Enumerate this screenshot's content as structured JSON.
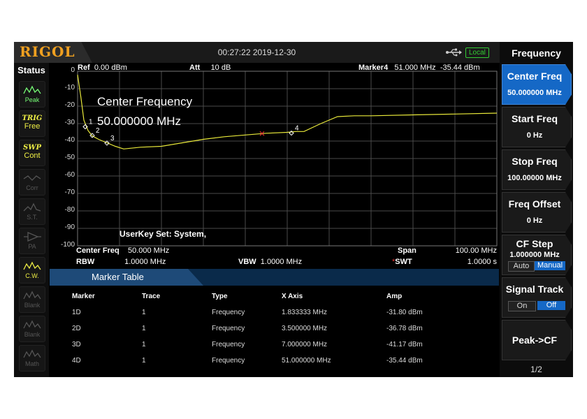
{
  "topbar": {
    "logo": "RIGOL",
    "datetime": "00:27:22 2019-12-30",
    "remote_badge": "Local"
  },
  "status": {
    "title": "Status",
    "items": [
      {
        "label": "Peak",
        "icon": "peak-search-icon",
        "state": "on"
      },
      {
        "icon_text": "TRIG",
        "label": "Free",
        "state": "yellow"
      },
      {
        "icon_text": "SWP",
        "label": "Cont",
        "state": "yellow"
      },
      {
        "label": "Corr",
        "icon": "correction-icon",
        "state": "dim"
      },
      {
        "label": "S.T.",
        "icon": "signal-track-icon",
        "state": "dim"
      },
      {
        "label": "PA",
        "icon": "preamp-icon",
        "state": "dim"
      },
      {
        "label": "C.W.",
        "icon": "clear-write-icon",
        "state": "yellow"
      },
      {
        "label": "Blank",
        "icon": "trace-blank-icon",
        "state": "dim"
      },
      {
        "label": "Blank",
        "icon": "trace-blank-icon",
        "state": "dim"
      },
      {
        "label": "Math",
        "icon": "trace-math-icon",
        "state": "dim"
      }
    ]
  },
  "header": {
    "ref_label": "Ref",
    "ref_value": "0.00 dBm",
    "att_label": "Att",
    "att_value": "10 dB",
    "marker_label": "Marker4",
    "marker_freq": "51.000 MHz",
    "marker_amp": "-35.44 dBm"
  },
  "y_axis_labels": [
    "0",
    "-10",
    "-20",
    "-30",
    "-40",
    "-50",
    "-60",
    "-70",
    "-80",
    "-90",
    "-100"
  ],
  "overlay": {
    "line1": "Center Frequency",
    "line2": "50.000000 MHz",
    "userkey": "UserKey Set:    System,"
  },
  "footer": {
    "center_freq_label": "Center Freq",
    "center_freq_value": "50.000 MHz",
    "span_label": "Span",
    "span_value": "100.00 MHz",
    "rbw_label": "RBW",
    "rbw_value": "1.0000 MHz",
    "vbw_label": "VBW",
    "vbw_value": "1.0000 MHz",
    "swt_flag": "*",
    "swt_label": "SWT",
    "swt_value": "1.0000 s"
  },
  "chart_data": {
    "type": "line",
    "x_range_mhz": [
      0,
      100
    ],
    "ylim": [
      -100,
      0
    ],
    "y_unit": "dBm",
    "grid": true,
    "series": [
      {
        "x": [
          0,
          0.8,
          1.5,
          2.5,
          3.5,
          5,
          7,
          9,
          11,
          15,
          20,
          25,
          30,
          35,
          40,
          45,
          50,
          52,
          54,
          58,
          62,
          66,
          70,
          80,
          90,
          100
        ],
        "y": [
          -2,
          -15,
          -28,
          -34,
          -37,
          -39,
          -41,
          -43,
          -44.5,
          -43.5,
          -43,
          -41,
          -39,
          -37.5,
          -36.5,
          -35.5,
          -35,
          -34.5,
          -34.5,
          -30,
          -26,
          -25.5,
          -25.5,
          -25,
          -24.5,
          -24
        ]
      }
    ],
    "markers": [
      {
        "label": "1",
        "x": 1.833333,
        "y": -31.8
      },
      {
        "label": "2",
        "x": 3.5,
        "y": -36.78
      },
      {
        "label": "3",
        "x": 7.0,
        "y": -41.17
      },
      {
        "label": "4",
        "x": 51.0,
        "y": -35.44
      }
    ],
    "extra_marker_x": [
      44
    ]
  },
  "marker_table": {
    "title": "Marker Table",
    "columns": [
      "Marker",
      "Trace",
      "Type",
      "X Axis",
      "Amp"
    ],
    "rows": [
      [
        "1D",
        "1",
        "Frequency",
        "1.833333 MHz",
        "-31.80 dBm"
      ],
      [
        "2D",
        "1",
        "Frequency",
        "3.500000 MHz",
        "-36.78 dBm"
      ],
      [
        "3D",
        "1",
        "Frequency",
        "7.000000 MHz",
        "-41.17 dBm"
      ],
      [
        "4D",
        "1",
        "Frequency",
        "51.000000 MHz",
        "-35.44 dBm"
      ]
    ]
  },
  "menu": {
    "title": "Frequency",
    "buttons": [
      {
        "label": "Center Freq",
        "value": "50.000000 MHz",
        "active": true
      },
      {
        "label": "Start Freq",
        "value": "0 Hz"
      },
      {
        "label": "Stop Freq",
        "value": "100.00000 MHz"
      },
      {
        "label": "Freq Offset",
        "value": "0 Hz"
      },
      {
        "label": "CF Step",
        "value": "1.000000 MHz",
        "toggle": [
          "Auto",
          "Manual"
        ],
        "selected": "Manual"
      },
      {
        "label": "Signal Track",
        "toggle": [
          "On",
          "Off"
        ],
        "selected": "Off"
      },
      {
        "label": "Peak->CF"
      }
    ],
    "page": "1/2"
  },
  "colors": {
    "trace": "#e8e83a",
    "marker_active": "#e03030",
    "menu_active": "#1568c6",
    "table_header": "#1e4a78",
    "grid": "#4a4a4a"
  }
}
